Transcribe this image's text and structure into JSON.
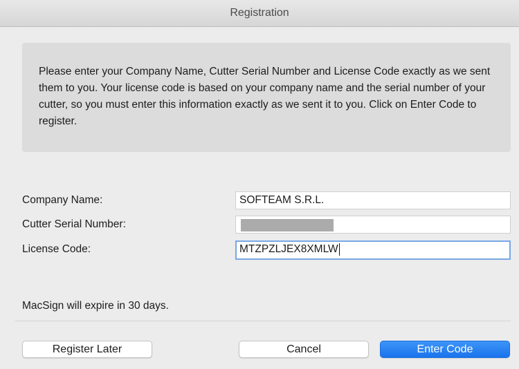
{
  "window": {
    "title": "Registration"
  },
  "info": {
    "text": "Please enter your Company Name, Cutter Serial Number and License Code exactly as we sent them to you. Your license code is based on your company name and the serial number of your cutter, so you must enter this information exactly as we sent it to you. Click on Enter Code to register."
  },
  "form": {
    "company_label": "Company Name:",
    "company_value": "SOFTEAM S.R.L.",
    "serial_label": "Cutter Serial Number:",
    "serial_value": "",
    "license_label": "License Code:",
    "license_value": "MTZPZLJEX8XMLW"
  },
  "expiry": {
    "text": "MacSign will expire in 30 days."
  },
  "buttons": {
    "register_later": "Register Later",
    "cancel": "Cancel",
    "enter_code": "Enter Code"
  },
  "colors": {
    "primary_button": "#1a73ec",
    "focus_ring": "#78a7e6",
    "redaction": "#ababab"
  }
}
